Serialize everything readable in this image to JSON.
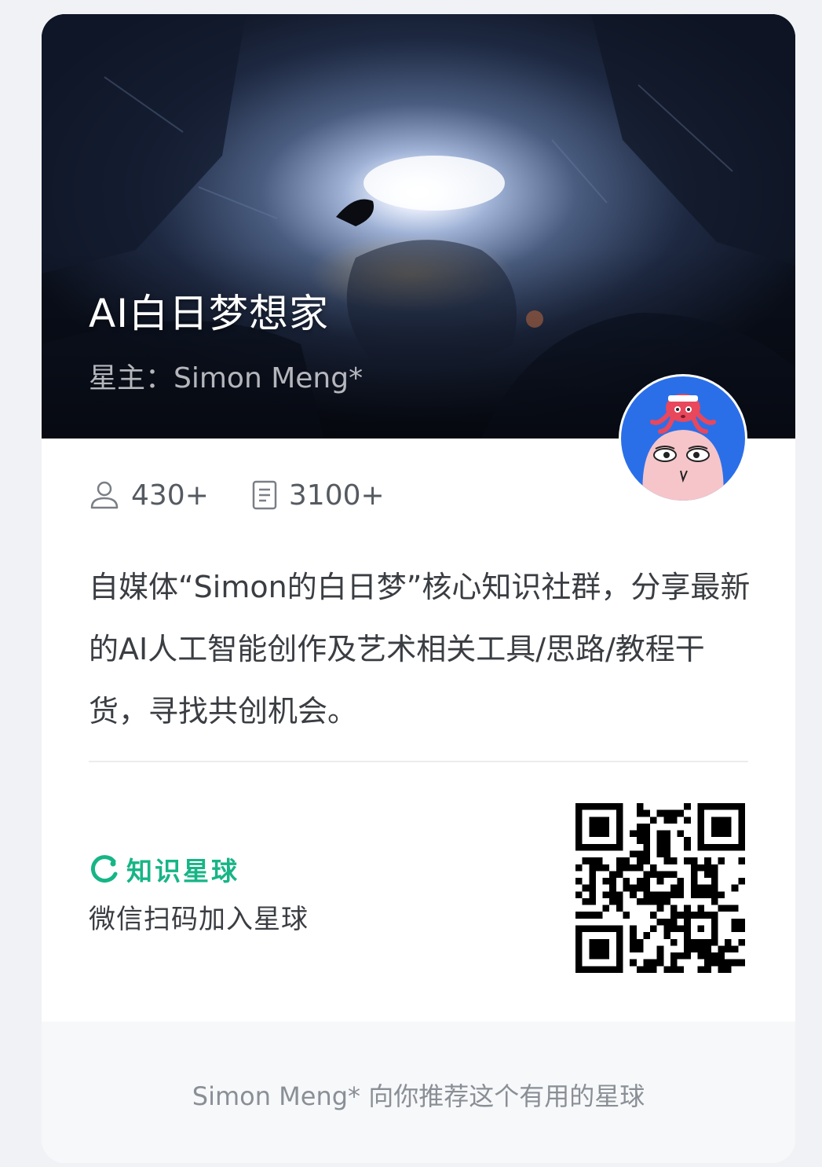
{
  "card": {
    "title": "AI白日梦想家",
    "owner": "星主：Simon Meng*",
    "cover_image": "glowing-cave-image",
    "avatar": "octopus-cartoon-avatar"
  },
  "stats": {
    "members": "430+",
    "members_icon": "user-icon",
    "posts": "3100+",
    "posts_icon": "document-icon"
  },
  "description": "自媒体“Simon的白日梦”核心知识社群，分享最新的AI人工智能创作及艺术相关工具/思路/教程干货，寻找共创机会。",
  "join": {
    "brand": "知识星球",
    "brand_icon": "zsxq-logo-icon",
    "instruction": "微信扫码加入星球",
    "qr": "qr-code"
  },
  "footer": {
    "text": "Simon Meng* 向你推荐这个有用的星球"
  },
  "colors": {
    "brand_green": "#17b586",
    "avatar_blue": "#2b6fe8",
    "footer_bg": "#f7f8fa"
  }
}
